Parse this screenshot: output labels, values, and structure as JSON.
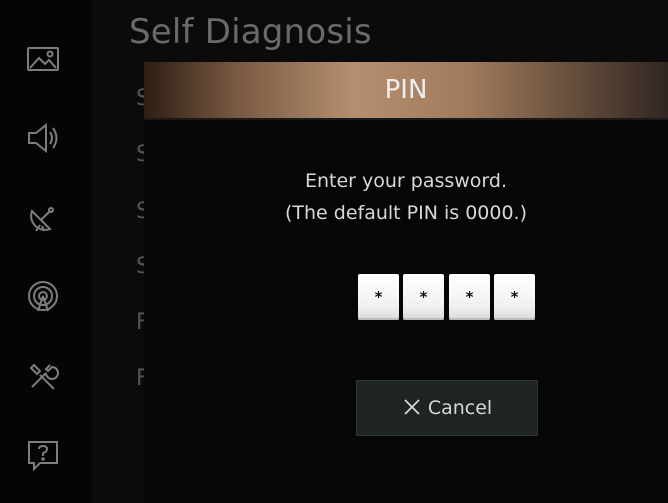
{
  "menu": {
    "title": "Self Diagnosis",
    "peek_letters": [
      "S",
      "S",
      "S",
      "S",
      "F",
      "F"
    ]
  },
  "sidebar": {
    "icons": [
      {
        "name": "picture-icon"
      },
      {
        "name": "sound-icon"
      },
      {
        "name": "broadcasting-icon"
      },
      {
        "name": "network-icon"
      },
      {
        "name": "system-tools-icon"
      },
      {
        "name": "support-icon"
      }
    ]
  },
  "dialog": {
    "title": "PIN",
    "prompt_line1": "Enter your password.",
    "prompt_line2": "(The default PIN is 0000.)",
    "pin_digits": [
      "*",
      "*",
      "*",
      "*"
    ],
    "cancel_label": "Cancel"
  },
  "colors": {
    "background": "#000000",
    "dialog_header_accent": "#b58f6f",
    "button_background": "#1e2324",
    "pin_box": "#ffffff"
  }
}
